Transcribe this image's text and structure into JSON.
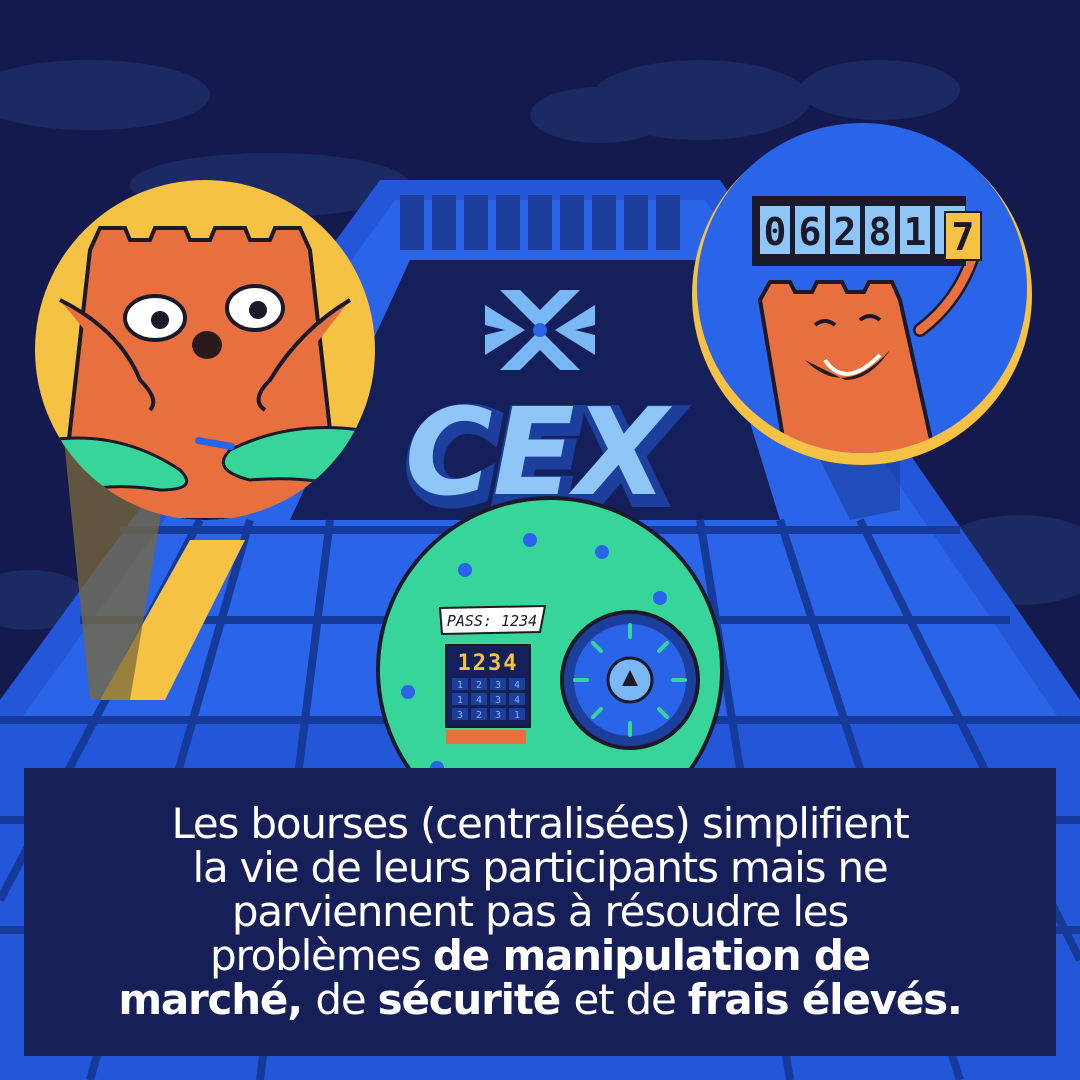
{
  "logo": {
    "title": "CEX"
  },
  "counter": {
    "digits": "062817"
  },
  "safe": {
    "note": "PASS: 1234",
    "keypad_display": "1234",
    "keypad_keys": [
      "1",
      "2",
      "3",
      "4",
      "1",
      "4",
      "3",
      "4",
      "3",
      "2",
      "3",
      "1"
    ]
  },
  "caption": {
    "line1": "Les bourses (centralisées) simplifient",
    "line2": "la vie de leurs participants mais ne",
    "line3": "parviennent pas à résoudre les",
    "line4_normal": "problèmes ",
    "line4_bold": "de manipulation de",
    "line5_bold_a": "marché, ",
    "line5_normal_a": "de ",
    "line5_bold_b": "sécurité ",
    "line5_normal_b": "et de ",
    "line5_bold_c": "frais élevés."
  },
  "colors": {
    "background": "#141a4d",
    "grid": "#2356d8",
    "accent_blue": "#7ab8f5",
    "orange": "#e8703f",
    "yellow": "#f6c243",
    "green": "#38d59b",
    "caption_bg": "#161f58"
  }
}
